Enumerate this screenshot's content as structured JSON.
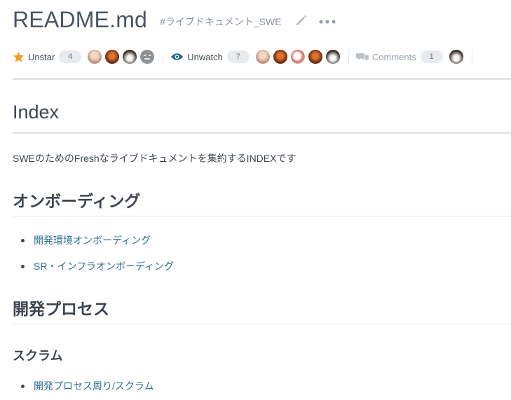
{
  "header": {
    "title": "README.md",
    "tag": "#ライブドキュメント_SWE",
    "edit_icon": "pencil-icon",
    "more_icon": "ellipsis-icon"
  },
  "actions": {
    "star": {
      "label": "Unstar",
      "count": "4",
      "icon": "star-icon",
      "color": "#f0a022"
    },
    "watch": {
      "label": "Unwatch",
      "count": "7",
      "icon": "eye-icon",
      "color": "#1d6a8a"
    },
    "comments": {
      "label": "Comments",
      "count": "1",
      "icon": "comments-icon"
    }
  },
  "content": {
    "h1": "Index",
    "intro": "SWEのためのFreshなライブドキュメントを集約するINDEXです",
    "section1": {
      "heading": "オンボーディング",
      "items": [
        "開発環境オンボーディング",
        "SR・インフラオンボーディング"
      ]
    },
    "section2": {
      "heading": "開発プロセス",
      "subheading": "スクラム",
      "items": [
        "開発プロセス周り/スクラム"
      ]
    }
  },
  "colors": {
    "link": "#2b6f93",
    "text": "#3d4550",
    "muted": "#8a939c"
  }
}
